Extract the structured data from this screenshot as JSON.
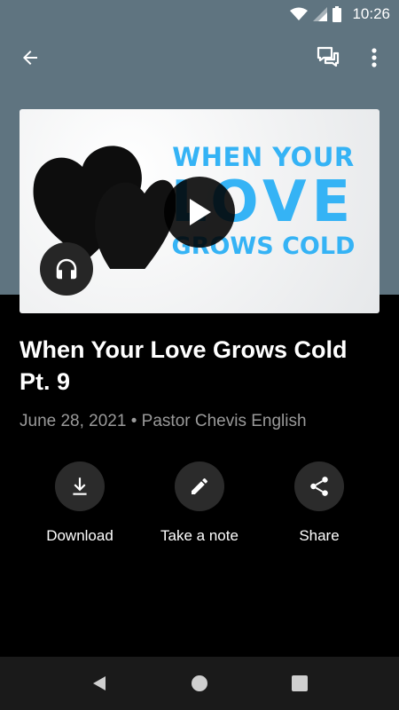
{
  "status_bar": {
    "time": "10:26"
  },
  "episode": {
    "title": "When Your Love Grows Cold Pt. 9",
    "date": "June 28, 2021",
    "separator": "•",
    "speaker": "Pastor Chevis English"
  },
  "artwork": {
    "line1": "WHEN YOUR",
    "line2": "LOVE",
    "line3": "GROWS COLD",
    "text_color": "#35b3f5"
  },
  "actions": [
    {
      "label": "Download",
      "icon": "download-icon"
    },
    {
      "label": "Take a note",
      "icon": "pencil-icon"
    },
    {
      "label": "Share",
      "icon": "share-icon"
    }
  ],
  "colors": {
    "header_bg": "#5f7480",
    "page_bg": "#000000",
    "meta_text": "#9a9a9a",
    "action_circle": "#2b2b2b"
  }
}
